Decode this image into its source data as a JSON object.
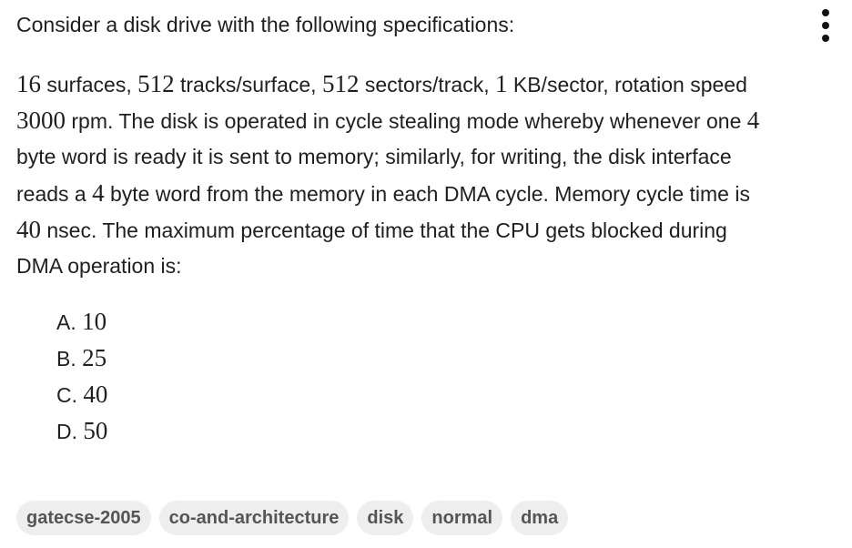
{
  "question": {
    "title": "Consider a disk drive with the following specifications:",
    "more_icon": "vertical-ellipsis-icon",
    "lines": [
      [
        {
          "t": "m",
          "v": "16"
        },
        {
          "t": "x",
          "v": " surfaces, "
        },
        {
          "t": "m",
          "v": "512"
        },
        {
          "t": "x",
          "v": " tracks/surface, "
        },
        {
          "t": "m",
          "v": "512"
        },
        {
          "t": "x",
          "v": " sectors/track, "
        },
        {
          "t": "m",
          "v": "1"
        },
        {
          "t": "x",
          "v": " KB/sector, rotation speed"
        }
      ],
      [
        {
          "t": "m",
          "v": "3000"
        },
        {
          "t": "x",
          "v": " rpm. The disk is operated in cycle stealing mode whereby whenever one "
        },
        {
          "t": "m",
          "v": "4"
        }
      ],
      [
        {
          "t": "x",
          "v": "byte word is ready it is sent to memory; similarly, for writing, the disk interface"
        }
      ],
      [
        {
          "t": "x",
          "v": "reads a "
        },
        {
          "t": "m",
          "v": "4"
        },
        {
          "t": "x",
          "v": " byte word from the memory in each DMA cycle. Memory cycle time is"
        }
      ],
      [
        {
          "t": "m",
          "v": "40"
        },
        {
          "t": "x",
          "v": " nsec. The maximum percentage of time that the CPU gets blocked during"
        }
      ],
      [
        {
          "t": "x",
          "v": "DMA operation is:"
        }
      ]
    ]
  },
  "options": [
    {
      "letter": "A.",
      "value": "10"
    },
    {
      "letter": "B.",
      "value": "25"
    },
    {
      "letter": "C.",
      "value": "40"
    },
    {
      "letter": "D.",
      "value": "50"
    }
  ],
  "tags": [
    "gatecse-2005",
    "co-and-architecture",
    "disk",
    "normal",
    "dma"
  ]
}
